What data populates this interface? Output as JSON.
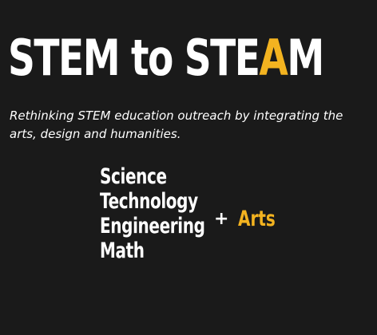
{
  "headline": {
    "part1": "STEM to STE",
    "accent": "A",
    "part2": "M"
  },
  "tagline": "Rethinking STEM education outreach by integrating the arts, design and humanities.",
  "stem_subjects": [
    "Science",
    "Technology",
    "Engineering",
    "Math"
  ],
  "plus_sign": "+",
  "arts_label": "Arts",
  "colors": {
    "background": "#1a1a1a",
    "text": "#ffffff",
    "accent": "#f3b320"
  }
}
